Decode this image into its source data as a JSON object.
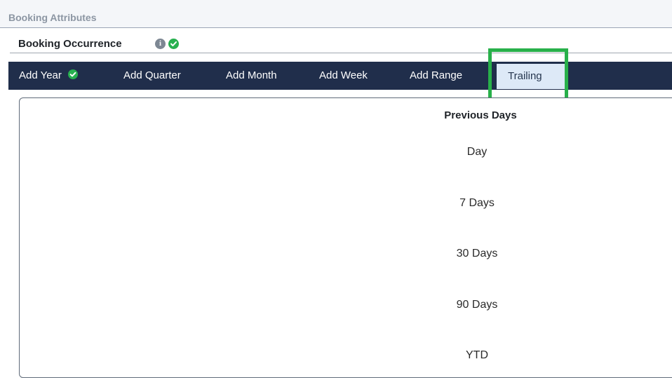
{
  "section": {
    "title": "Booking Attributes"
  },
  "subsection": {
    "title": "Booking Occurrence",
    "info_icon": "info-icon",
    "status_icon": "check-circle-icon"
  },
  "tabs": [
    {
      "label": "Add Year",
      "completed": true
    },
    {
      "label": "Add Quarter",
      "completed": false
    },
    {
      "label": "Add Month",
      "completed": false
    },
    {
      "label": "Add Week",
      "completed": false
    },
    {
      "label": "Add Range",
      "completed": false
    },
    {
      "label": "Trailing",
      "active": true
    }
  ],
  "panel": {
    "heading": "Previous Days",
    "options": [
      "Day",
      "7 Days",
      "30 Days",
      "90 Days",
      "YTD"
    ]
  },
  "colors": {
    "tabbar": "#202e4b",
    "active_tab": "#dde9f7",
    "success": "#27b04f",
    "highlight": "#28b04a"
  }
}
